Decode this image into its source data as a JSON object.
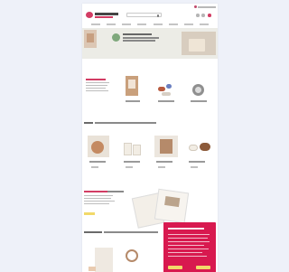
{
  "colors": {
    "brand": "#d23c64",
    "banner": "#d8194f",
    "banner_button": "#f2d96a",
    "canvas": "#eef1f9"
  },
  "header": {
    "logo_icon": "brand-logo-icon",
    "search_icon": "search-icon",
    "icons": [
      "account-icon",
      "wishlist-icon",
      "cart-icon"
    ]
  },
  "sections": [
    {
      "name": "hero-banner"
    },
    {
      "name": "product-grid-1"
    },
    {
      "name": "product-grid-2"
    },
    {
      "name": "catalog-promo"
    },
    {
      "name": "product-grid-3"
    }
  ],
  "cookie_banner": {
    "buttons": [
      "accept-button",
      "settings-button"
    ]
  }
}
